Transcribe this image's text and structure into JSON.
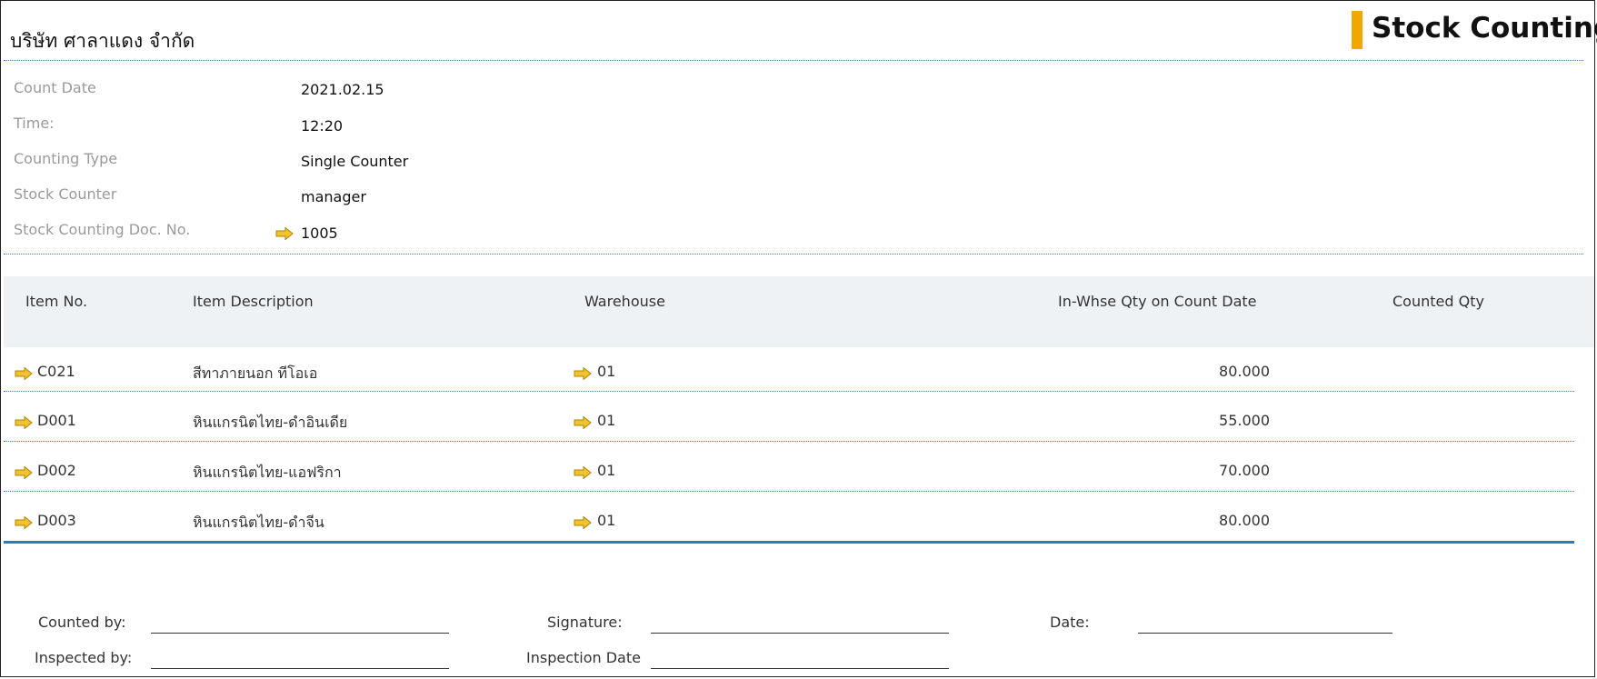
{
  "header": {
    "company": "บริษัท ศาลาแดง จำกัด",
    "title": "Stock Counting",
    "accent_color": "#f0a800"
  },
  "info": {
    "count_date_label": "Count Date",
    "count_date": "2021.02.15",
    "time_label": "Time:",
    "time": "12:20",
    "counting_type_label": "Counting Type",
    "counting_type": "Single Counter",
    "stock_counter_label": "Stock Counter",
    "stock_counter": "manager",
    "doc_no_label": "Stock Counting Doc. No.",
    "doc_no": "1005"
  },
  "table": {
    "columns": [
      "Item No.",
      "Item Description",
      "Warehouse",
      "In-Whse Qty on Count Date",
      "Counted Qty"
    ],
    "rows": [
      {
        "item_no": "C021",
        "description": "สีทาภายนอก ทีโอเอ",
        "warehouse": "01",
        "qty": "80.000",
        "counted": ""
      },
      {
        "item_no": "D001",
        "description": "หินแกรนิตไทย-ดำอินเดีย",
        "warehouse": "01",
        "qty": "55.000",
        "counted": ""
      },
      {
        "item_no": "D002",
        "description": "หินแกรนิตไทย-แอฟริกา",
        "warehouse": "01",
        "qty": "70.000",
        "counted": ""
      },
      {
        "item_no": "D003",
        "description": "หินแกรนิตไทย-ดำจีน",
        "warehouse": "01",
        "qty": "80.000",
        "counted": ""
      }
    ]
  },
  "footer": {
    "counted_by": "Counted by:",
    "signature": "Signature:",
    "date": "Date:",
    "inspected_by": "Inspected by:",
    "inspection_date": "Inspection Date"
  },
  "icons": {
    "link_arrow": "link-arrow-icon",
    "arrow_color": "#f2c230"
  }
}
